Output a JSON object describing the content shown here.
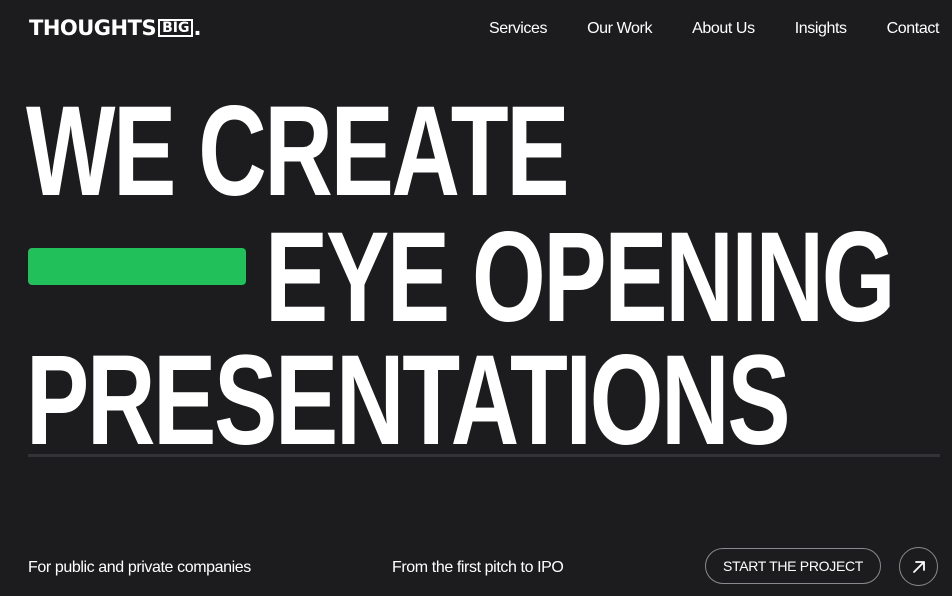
{
  "header": {
    "logo": {
      "main": "THOUGHTS",
      "boxed": "BIG",
      "dot": "."
    },
    "nav": [
      {
        "label": "Services"
      },
      {
        "label": "Our Work"
      },
      {
        "label": "About Us"
      },
      {
        "label": "Insights"
      },
      {
        "label": "Contact"
      }
    ]
  },
  "hero": {
    "line1": "WE CREATE",
    "line2": "EYE OPENING",
    "line3": "PRESENTATIONS",
    "accent_color": "#21c05a"
  },
  "footer": {
    "left_text": "For public and private companies",
    "mid_text": "From the first pitch to IPO",
    "cta_label": "START THE PROJECT",
    "cta_icon": "arrow-up-right-icon"
  },
  "colors": {
    "background": "#1c1b1d",
    "text": "#ffffff",
    "accent": "#21c05a"
  }
}
